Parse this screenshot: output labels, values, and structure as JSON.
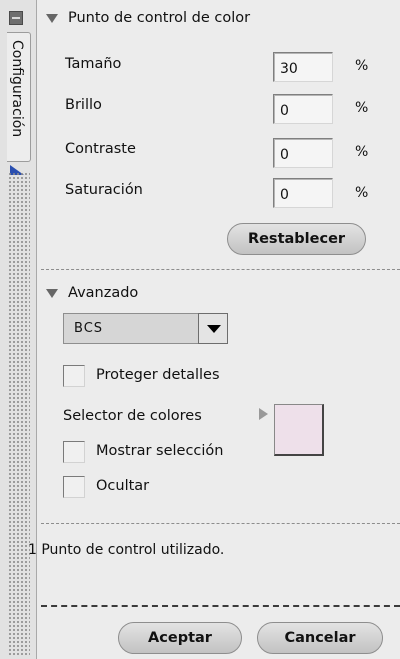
{
  "side_tab": {
    "label": "Configuración"
  },
  "color_point": {
    "title": "Punto de control de color",
    "fields": [
      {
        "label": "Tamaño",
        "value": "30",
        "unit": "%"
      },
      {
        "label": "Brillo",
        "value": "0",
        "unit": "%"
      },
      {
        "label": "Contraste",
        "value": "0",
        "unit": "%"
      },
      {
        "label": "Saturación",
        "value": "0",
        "unit": "%"
      }
    ],
    "reset_label": "Restablecer"
  },
  "advanced": {
    "title": "Avanzado",
    "mode_selected": "BCS",
    "protect_details_label": "Proteger detalles",
    "color_picker_label": "Selector de colores",
    "swatch_color": "#eee0ea",
    "show_selection_label": "Mostrar selección",
    "hide_label": "Ocultar"
  },
  "status": {
    "text": "1 Punto de control utilizado."
  },
  "footer": {
    "ok_label": "Aceptar",
    "cancel_label": "Cancelar"
  }
}
